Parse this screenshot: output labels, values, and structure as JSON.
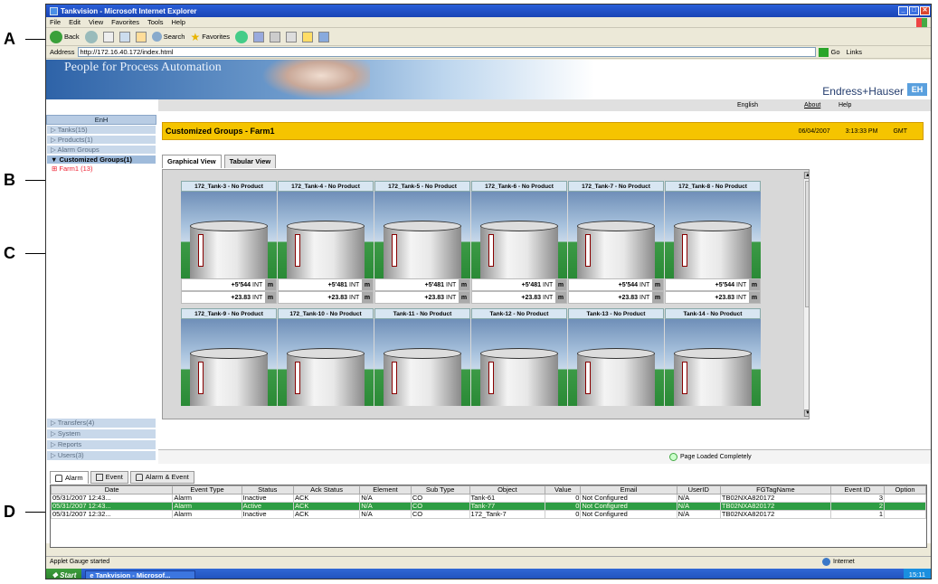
{
  "callouts": [
    "A",
    "B",
    "C",
    "D"
  ],
  "window": {
    "title": "Tankvision - Microsoft Internet Explorer"
  },
  "menu": [
    "File",
    "Edit",
    "View",
    "Favorites",
    "Tools",
    "Help"
  ],
  "toolbar": {
    "back": "Back",
    "search": "Search",
    "favorites": "Favorites"
  },
  "address": {
    "label": "Address",
    "url": "http://172.16.40.172/index.html",
    "go": "Go",
    "links": "Links"
  },
  "banner": {
    "slogan": "People for Process Automation",
    "brand": "Endress+Hauser",
    "logo": "EH"
  },
  "toplinks": {
    "language": "English",
    "about": "About",
    "help": "Help"
  },
  "sidebar": {
    "head": "EnH",
    "items": [
      "Tanks(15)",
      "Products(1)",
      "Alarm Groups",
      "Customized Groups(1)"
    ],
    "sub": "Farm1 (13)",
    "bottom": [
      "Transfers(4)",
      "System",
      "Reports",
      "Users(3)"
    ]
  },
  "group": {
    "title": "Customized Groups - Farm1",
    "date": "06/04/2007",
    "time": "3:13:33 PM",
    "tz": "GMT"
  },
  "view_tabs": [
    "Graphical View",
    "Tabular View"
  ],
  "tanks": [
    {
      "name": "172_Tank-3 - No Product",
      "level": "+5'544",
      "temp": "+23.83"
    },
    {
      "name": "172_Tank-4 - No Product",
      "level": "+5'481",
      "temp": "+23.83"
    },
    {
      "name": "172_Tank-5 - No Product",
      "level": "+5'481",
      "temp": "+23.83"
    },
    {
      "name": "172_Tank-6 - No Product",
      "level": "+5'481",
      "temp": "+23.83"
    },
    {
      "name": "172_Tank-7 - No Product",
      "level": "+5'544",
      "temp": "+23.83"
    },
    {
      "name": "172_Tank-8 - No Product",
      "level": "+5'544",
      "temp": "+23.83"
    },
    {
      "name": "172_Tank-9 - No Product"
    },
    {
      "name": "172_Tank-10 - No Product"
    },
    {
      "name": "Tank-11 - No Product"
    },
    {
      "name": "Tank-12 - No Product"
    },
    {
      "name": "Tank-13 - No Product"
    },
    {
      "name": "Tank-14 - No Product"
    }
  ],
  "units": {
    "int": "INT",
    "m": "m"
  },
  "status": {
    "loaded": "Page Loaded Completely"
  },
  "alarm_tabs": [
    "Alarm",
    "Event",
    "Alarm & Event"
  ],
  "alarm_table": {
    "headers": [
      "Date",
      "Event Type",
      "Status",
      "Ack Status",
      "Element",
      "Sub Type",
      "Object",
      "Value",
      "Email",
      "UserID",
      "FGTagName",
      "Event ID",
      "Option"
    ],
    "rows": [
      [
        "05/31/2007 12:43...",
        "Alarm",
        "Inactive",
        "ACK",
        "N/A",
        "CO",
        "Tank-61",
        "0",
        "Not Configured",
        "N/A",
        "TB02NXA820172",
        "3",
        ""
      ],
      [
        "05/31/2007 12:43...",
        "Alarm",
        "Active",
        "ACK",
        "N/A",
        "CO",
        "Tank-77",
        "0",
        "Not Configured",
        "N/A",
        "TB02NXA820172",
        "2",
        ""
      ],
      [
        "05/31/2007 12:32...",
        "Alarm",
        "Inactive",
        "ACK",
        "N/A",
        "CO",
        "172_Tank-7",
        "0",
        "Not Configured",
        "N/A",
        "TB02NXA820172",
        "1",
        ""
      ]
    ]
  },
  "ie_status": {
    "left": "Applet Gauge started",
    "zone": "Internet"
  },
  "taskbar": {
    "start": "Start",
    "task": "Tankvision - Microsof...",
    "clock": "15:11"
  }
}
